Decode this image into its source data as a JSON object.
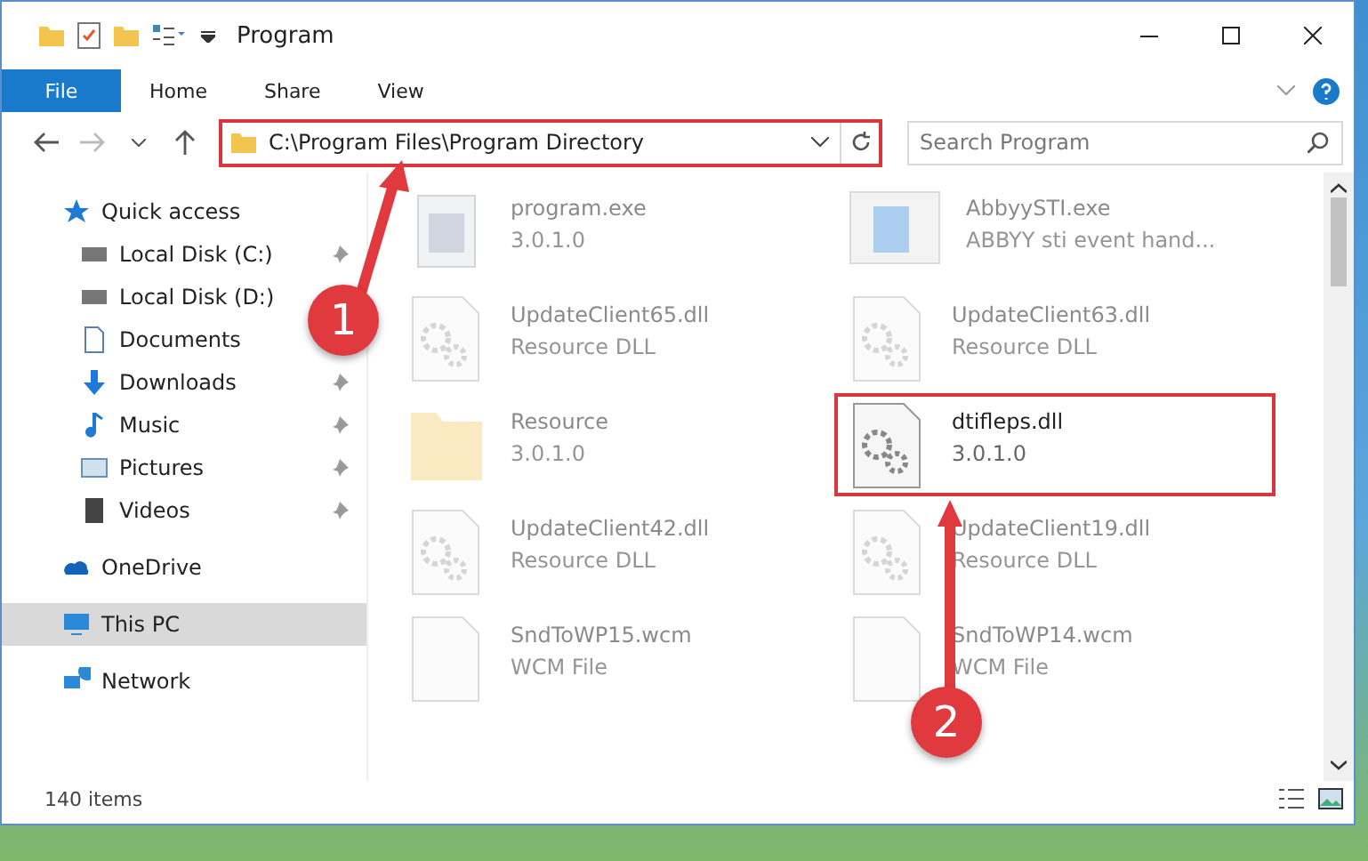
{
  "window": {
    "title": "Program"
  },
  "ribbon": {
    "tabs": [
      {
        "label": "File",
        "selected": true
      },
      {
        "label": "Home",
        "selected": false
      },
      {
        "label": "Share",
        "selected": false
      },
      {
        "label": "View",
        "selected": false
      }
    ]
  },
  "address_bar": {
    "path": "C:\\Program Files\\Program Directory",
    "highlighted": true
  },
  "search": {
    "placeholder": "Search Program"
  },
  "sidebar": {
    "items": [
      {
        "label": "Quick access",
        "kind": "star",
        "pinned": false,
        "selected": false,
        "children": [
          {
            "label": "Local Disk (C:)",
            "kind": "disk",
            "pinned": true,
            "selected": false
          },
          {
            "label": "Local Disk (D:)",
            "kind": "disk",
            "pinned": false,
            "selected": false
          },
          {
            "label": "Documents",
            "kind": "document",
            "pinned": false,
            "selected": false
          },
          {
            "label": "Downloads",
            "kind": "download",
            "pinned": true,
            "selected": false
          },
          {
            "label": "Music",
            "kind": "music",
            "pinned": true,
            "selected": false
          },
          {
            "label": "Pictures",
            "kind": "picture",
            "pinned": true,
            "selected": false
          },
          {
            "label": "Videos",
            "kind": "video",
            "pinned": true,
            "selected": false
          }
        ]
      },
      {
        "label": "OneDrive",
        "kind": "cloud",
        "pinned": false,
        "selected": false
      },
      {
        "label": "This PC",
        "kind": "pc",
        "pinned": false,
        "selected": true
      },
      {
        "label": "Network",
        "kind": "network",
        "pinned": false,
        "selected": false
      }
    ]
  },
  "files": [
    {
      "name": "program.exe",
      "detail": "3.0.1.0",
      "kind": "exe",
      "faded": true,
      "highlighted": false
    },
    {
      "name": "AbbyySTI.exe",
      "detail": "ABBYY sti event hand...",
      "kind": "app",
      "faded": true,
      "highlighted": false
    },
    {
      "name": "UpdateClient65.dll",
      "detail": "Resource DLL",
      "kind": "dll",
      "faded": true,
      "highlighted": false
    },
    {
      "name": "UpdateClient63.dll",
      "detail": "Resource DLL",
      "kind": "dll",
      "faded": true,
      "highlighted": false
    },
    {
      "name": "Resource",
      "detail": "3.0.1.0",
      "kind": "folder",
      "faded": true,
      "highlighted": false
    },
    {
      "name": "dtifleps.dll",
      "detail": "3.0.1.0",
      "kind": "dll",
      "faded": false,
      "highlighted": true
    },
    {
      "name": "UpdateClient42.dll",
      "detail": "Resource DLL",
      "kind": "dll",
      "faded": true,
      "highlighted": false
    },
    {
      "name": "UpdateClient19.dll",
      "detail": "Resource DLL",
      "kind": "dll",
      "faded": true,
      "highlighted": false
    },
    {
      "name": "SndToWP15.wcm",
      "detail": "WCM File",
      "kind": "file",
      "faded": true,
      "highlighted": false
    },
    {
      "name": "SndToWP14.wcm",
      "detail": "WCM File",
      "kind": "file",
      "faded": true,
      "highlighted": false
    }
  ],
  "status_bar": {
    "count": "140 items"
  },
  "annotations": [
    {
      "label": "1"
    },
    {
      "label": "2"
    }
  ]
}
